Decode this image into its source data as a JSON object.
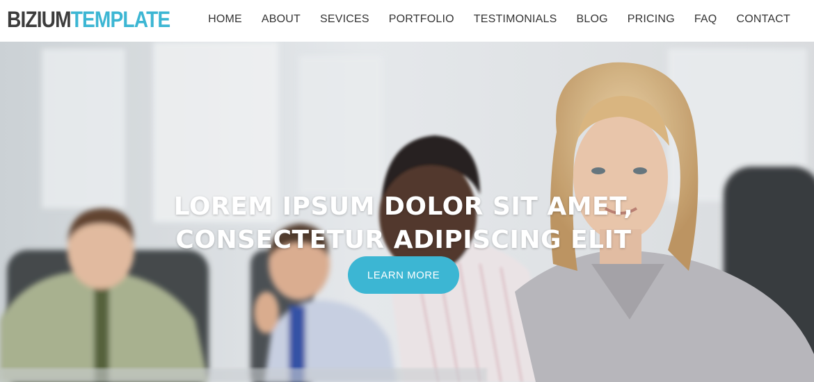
{
  "header": {
    "logo_part1": "BIZIUM",
    "logo_part2": "TEMPLATE",
    "nav": [
      "HOME",
      "ABOUT",
      "SEVICES",
      "PORTFOLIO",
      "TESTIMONIALS",
      "BLOG",
      "PRICING",
      "FAQ",
      "CONTACT"
    ]
  },
  "hero": {
    "headline_line1": "LOREM IPSUM DOLOR SIT AMET,",
    "headline_line2": "CONSECTETUR ADIPISCING ELIT",
    "cta_label": "LEARN MORE"
  },
  "colors": {
    "accent": "#3cb6d3",
    "logo_dark": "#3c3c3c",
    "nav_text": "#333333"
  }
}
